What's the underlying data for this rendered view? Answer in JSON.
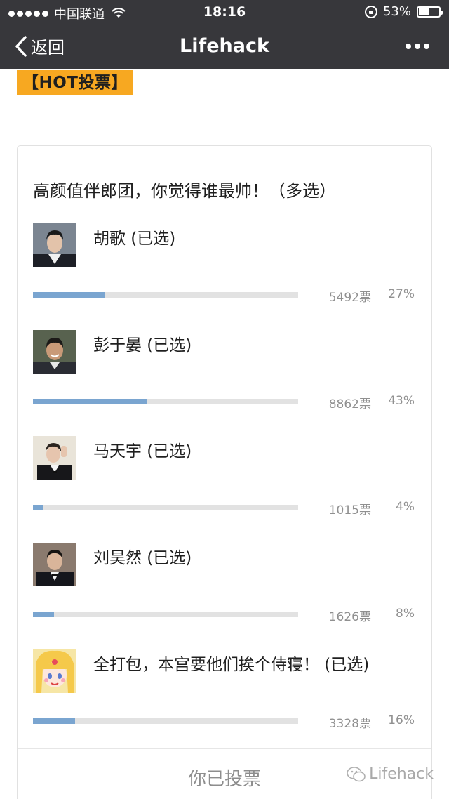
{
  "status_bar": {
    "carrier": "中国联通",
    "time": "18:16",
    "battery_percent": "53%",
    "battery_level": 0.53
  },
  "nav": {
    "back_label": "返回",
    "title": "Lifehack"
  },
  "tag": "【HOT投票】",
  "poll": {
    "question": "高颜值伴郎团，你觉得谁最帅！（多选）",
    "options": [
      {
        "label": "胡歌 (已选)",
        "votes": "5492票",
        "percent": "27%",
        "fraction": 0.27
      },
      {
        "label": "彭于晏 (已选)",
        "votes": "8862票",
        "percent": "43%",
        "fraction": 0.43
      },
      {
        "label": "马天宇 (已选)",
        "votes": "1015票",
        "percent": "4%",
        "fraction": 0.04
      },
      {
        "label": "刘昊然 (已选)",
        "votes": "1626票",
        "percent": "8%",
        "fraction": 0.08
      },
      {
        "label": "全打包，本宫要他们挨个侍寝！ (已选)",
        "votes": "3328票",
        "percent": "16%",
        "fraction": 0.16
      }
    ],
    "voted_label": "你已投票"
  },
  "watermark": "Lifehack",
  "colors": {
    "bar_fill": "#7aa5d0",
    "bar_track": "#e2e2e2",
    "nav_bg": "#37373b",
    "tag_bg": "#f7a821"
  }
}
